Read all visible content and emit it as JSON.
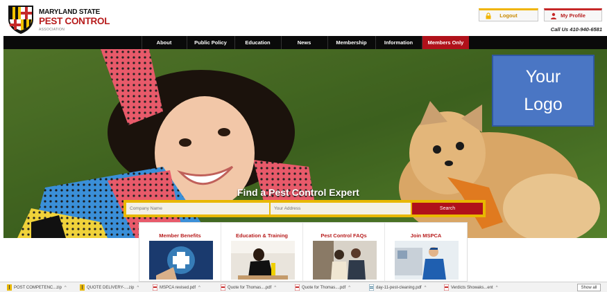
{
  "header": {
    "logo_line1": "MARYLAND STATE",
    "logo_line2": "PEST CONTROL",
    "logo_line3": "ASSOCIATION",
    "logout_label": "Logout",
    "profile_label": "My Profile",
    "call_us": "Call Us 410-940-6581"
  },
  "nav": {
    "items": [
      {
        "label": "About"
      },
      {
        "label": "Public Policy"
      },
      {
        "label": "Education"
      },
      {
        "label": "News"
      },
      {
        "label": "Membership"
      },
      {
        "label": "Information"
      },
      {
        "label": "Members Only",
        "active": true
      }
    ]
  },
  "hero": {
    "logo_placeholder_line1": "Your",
    "logo_placeholder_line2": "Logo",
    "find_title": "Find a Pest Control Expert",
    "company_placeholder": "Company Name",
    "address_placeholder": "Your Address",
    "search_label": "Search"
  },
  "cards": [
    {
      "title": "Member Benefits"
    },
    {
      "title": "Education & Training"
    },
    {
      "title": "Pest Control FAQs"
    },
    {
      "title": "Join MSPCA"
    }
  ],
  "downloads": {
    "items": [
      {
        "name": "POST COMPETENC...zip",
        "type": "zip"
      },
      {
        "name": "QUOTE DELIVERY-....zip",
        "type": "zip"
      },
      {
        "name": "MSPCA revised.pdf",
        "type": "pdf"
      },
      {
        "name": "Quote for Thomas....pdf",
        "type": "pdf"
      },
      {
        "name": "Quote for Thomas....pdf",
        "type": "pdf"
      },
      {
        "name": "day-11-pest-cleaning.pdf",
        "type": "doc"
      },
      {
        "name": "Verdicts Showaks...ent",
        "type": "pdf"
      }
    ],
    "show_all": "Show all"
  },
  "colors": {
    "brand_red": "#b0111a",
    "accent_gold": "#e8b800",
    "nav_bg": "#0a0a0a",
    "logo_placeholder_blue": "#4a76c4"
  }
}
